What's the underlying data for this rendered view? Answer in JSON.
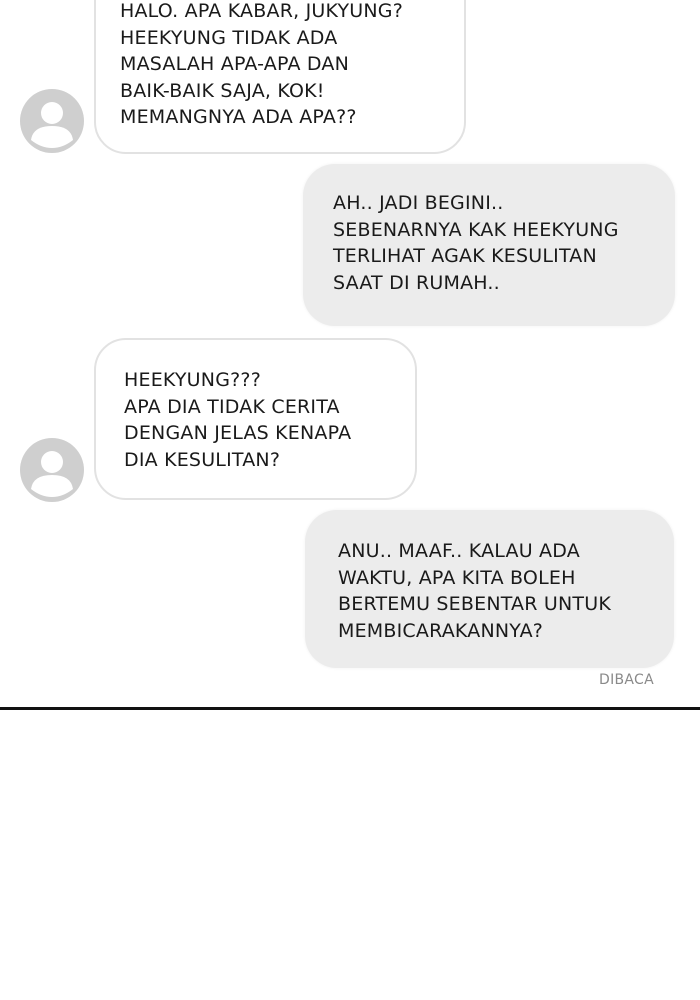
{
  "messages": [
    {
      "direction": "incoming",
      "lines": [
        "HALO. APA KABAR, JUKYUNG?",
        "HEEKYUNG TIDAK ADA",
        "MASALAH APA-APA DAN",
        "BAIK-BAIK SAJA, KOK!",
        "MEMANGNYA ADA APA??"
      ]
    },
    {
      "direction": "outgoing",
      "lines": [
        "AH.. JADI BEGINI..",
        "SEBENARNYA KAK HEEKYUNG",
        "TERLIHAT AGAK KESULITAN",
        "SAAT DI RUMAH.."
      ]
    },
    {
      "direction": "incoming",
      "lines": [
        "HEEKYUNG???",
        "APA DIA TIDAK CERITA",
        "DENGAN JELAS KENAPA",
        "DIA KESULITAN?"
      ]
    },
    {
      "direction": "outgoing",
      "lines": [
        "ANU.. MAAF.. KALAU ADA",
        "WAKTU, APA KITA BOLEH",
        "BERTEMU SEBENTAR UNTUK",
        "MEMBICARAKANNYA?"
      ]
    }
  ],
  "read_receipt": "DIBACA",
  "colors": {
    "incoming_bubble_bg": "#ffffff",
    "incoming_bubble_border": "#e2e2e2",
    "outgoing_bubble_bg": "#ececec",
    "avatar_gray": "#cfcfcf",
    "text": "#1a1a1a",
    "receipt_text": "#8a8a8a",
    "divider": "#111111"
  },
  "icons": {
    "avatar": "default-user-avatar-icon"
  }
}
